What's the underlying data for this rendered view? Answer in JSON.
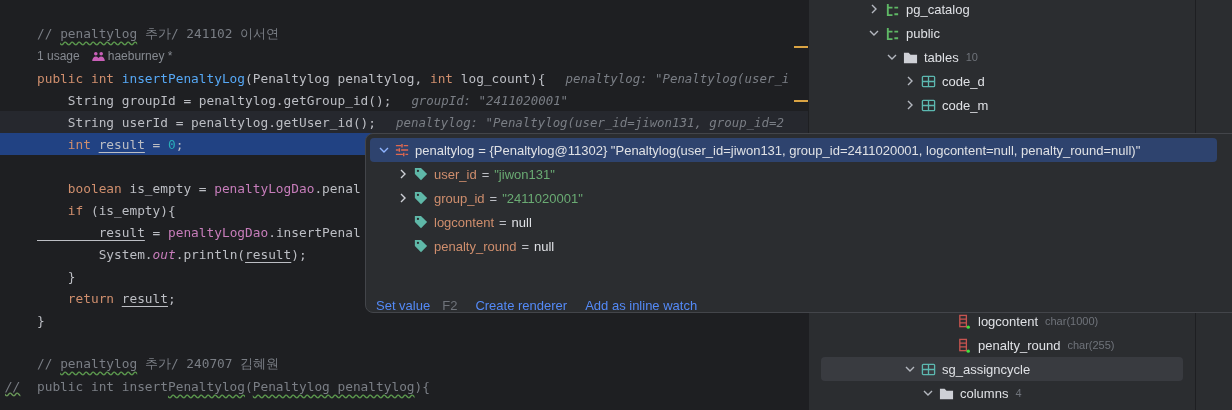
{
  "editor": {
    "lines": [
      {
        "tokens": [
          {
            "t": "// ",
            "kind": "comment"
          },
          {
            "t": "penaltylog",
            "kind": "comment-typo"
          },
          {
            "t": " 추가/ 241102 이서연",
            "kind": "comment"
          }
        ]
      },
      {
        "kind": "meta",
        "usage": "1 usage",
        "author": "haeburney *"
      },
      {
        "tokens": [
          {
            "t": "public int ",
            "kind": "kw"
          },
          {
            "t": "insertPenaltyLog",
            "kind": "fn"
          },
          {
            "t": "(Penaltylog penaltylog, ",
            "kind": "plain"
          },
          {
            "t": "int ",
            "kind": "kw"
          },
          {
            "t": "log_count){",
            "kind": "plain"
          }
        ],
        "hint": "penaltylog: \"Penaltylog(user_i"
      },
      {
        "tokens": [
          {
            "t": "    String groupId = penaltylog.getGroup_id();",
            "kind": "plain"
          }
        ],
        "hint": "groupId: \"2411020001\""
      },
      {
        "kind": "caret",
        "tokens": [
          {
            "t": "    String userId = penaltylog.getUser_id();",
            "kind": "plain"
          }
        ],
        "hint": "penaltylog: \"Penaltylog(user_id=jiwon131, group_id=2"
      },
      {
        "kind": "execution",
        "tokens": [
          {
            "t": "    int ",
            "kind": "kw"
          },
          {
            "t": "result",
            "kind": "var"
          },
          {
            "t": " = ",
            "kind": "plain"
          },
          {
            "t": "0",
            "kind": "num"
          },
          {
            "t": ";",
            "kind": "plain"
          }
        ]
      },
      {
        "kind": "blank"
      },
      {
        "tokens": [
          {
            "t": "    boolean ",
            "kind": "kw"
          },
          {
            "t": "is_empty = ",
            "kind": "plain"
          },
          {
            "t": "penaltyLogDao",
            "kind": "field"
          },
          {
            "t": ".penal",
            "kind": "plain"
          }
        ]
      },
      {
        "tokens": [
          {
            "t": "    if ",
            "kind": "kw"
          },
          {
            "t": "(is_empty){",
            "kind": "plain"
          }
        ]
      },
      {
        "tokens": [
          {
            "t": "        result",
            "kind": "var"
          },
          {
            "t": " = ",
            "kind": "plain"
          },
          {
            "t": "penaltyLogDao",
            "kind": "field"
          },
          {
            "t": ".insertPenal",
            "kind": "plain"
          }
        ]
      },
      {
        "tokens": [
          {
            "t": "        System.",
            "kind": "plain"
          },
          {
            "t": "out",
            "kind": "static"
          },
          {
            "t": ".println(",
            "kind": "plain"
          },
          {
            "t": "result",
            "kind": "var"
          },
          {
            "t": ");",
            "kind": "plain"
          }
        ]
      },
      {
        "tokens": [
          {
            "t": "    }",
            "kind": "plain"
          }
        ]
      },
      {
        "tokens": [
          {
            "t": "    return ",
            "kind": "kw"
          },
          {
            "t": "result",
            "kind": "var"
          },
          {
            "t": ";",
            "kind": "plain"
          }
        ]
      },
      {
        "tokens": [
          {
            "t": "}",
            "kind": "plain"
          }
        ]
      },
      {
        "kind": "blank"
      },
      {
        "tokens": [
          {
            "t": "// ",
            "kind": "comment"
          },
          {
            "t": "penaltylog",
            "kind": "comment-typo"
          },
          {
            "t": " 추가/ 240707 김혜원",
            "kind": "comment"
          }
        ]
      },
      {
        "gutter": "//",
        "tokens": [
          {
            "t": "public int insert",
            "kind": "comment"
          },
          {
            "t": "Penaltylog",
            "kind": "comment-typo"
          },
          {
            "t": "(",
            "kind": "comment"
          },
          {
            "t": "Penaltylog",
            "kind": "comment-typo"
          },
          {
            "t": " penaltylog",
            "kind": "comment-typo"
          },
          {
            "t": "){",
            "kind": "comment"
          }
        ]
      }
    ]
  },
  "debug_popup": {
    "root": {
      "name": "penaltylog",
      "value": "= {Penaltylog@11302} \"Penaltylog(user_id=jiwon131, group_id=2411020001, logcontent=null, penalty_round=null)\"",
      "expanded": true,
      "selected": true
    },
    "fields": [
      {
        "name": "user_id",
        "eq": "=",
        "value": "\"jiwon131\"",
        "kind": "string",
        "expanded": false
      },
      {
        "name": "group_id",
        "eq": "=",
        "value": "\"2411020001\"",
        "kind": "string",
        "expanded": false
      },
      {
        "name": "logcontent",
        "eq": "=",
        "value": "null",
        "kind": "null"
      },
      {
        "name": "penalty_round",
        "eq": "=",
        "value": "null",
        "kind": "null"
      }
    ],
    "actions": [
      {
        "label": "Set value",
        "shortcut": "F2"
      },
      {
        "label": "Create renderer"
      },
      {
        "label": "Add as inline watch"
      }
    ]
  },
  "database_tree": {
    "nodes": [
      {
        "label": "pg_catalog",
        "kind": "schema",
        "expanded": false,
        "selected": false
      },
      {
        "label": "public",
        "kind": "schema",
        "expanded": true,
        "selected": false,
        "children": [
          {
            "label": "tables",
            "kind": "folder",
            "count": "10",
            "expanded": true,
            "selected": false,
            "children": [
              {
                "label": "code_d",
                "kind": "table",
                "expanded": false,
                "selected": false
              },
              {
                "label": "code_m",
                "kind": "table",
                "expanded": false,
                "selected": false
              }
            ]
          }
        ]
      }
    ],
    "continued_nodes": [
      {
        "children": [
          {
            "children": [
              {
                "children": [
                  {
                    "children": [
                      {
                        "label": "logcontent",
                        "kind": "column",
                        "type": "char(1000)",
                        "selected": false
                      },
                      {
                        "label": "penalty_round",
                        "kind": "column",
                        "type": "char(255)",
                        "selected": false
                      }
                    ]
                  }
                ]
              },
              {
                "label": "sg_assigncycle",
                "kind": "table",
                "expanded": true,
                "selected": true,
                "children": [
                  {
                    "label": "columns",
                    "kind": "folder",
                    "count": "4",
                    "expanded": true,
                    "selected": false
                  }
                ]
              }
            ]
          }
        ]
      }
    ]
  }
}
